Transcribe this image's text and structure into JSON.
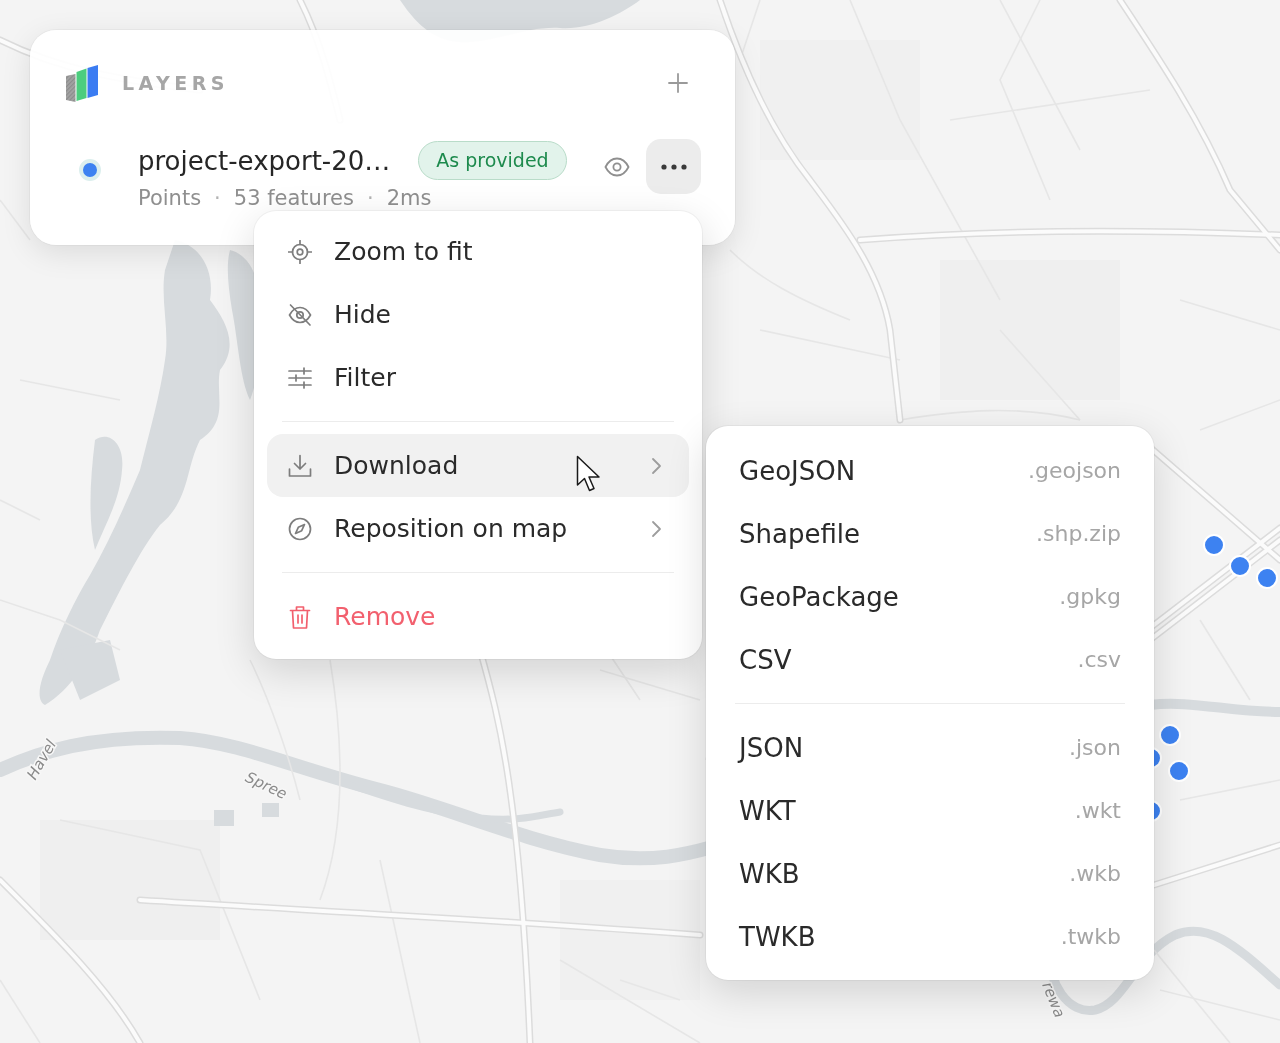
{
  "map": {
    "labels": [
      {
        "text": "Havel"
      },
      {
        "text": "Spree"
      },
      {
        "text": "rewa"
      }
    ]
  },
  "layers_panel": {
    "title": "LAYERS",
    "layers": [
      {
        "name": "project-export-20…",
        "selected": true,
        "badge": "As provided",
        "visible": true,
        "menu_open": true,
        "meta": [
          {
            "text": "Points"
          },
          {
            "separator": "·",
            "text": "53 features"
          },
          {
            "separator": "·",
            "text": "2ms"
          }
        ]
      }
    ]
  },
  "context_menu": {
    "groups": [
      {
        "items": [
          {
            "label": "Zoom to fit",
            "selected": false,
            "has_submenu": false,
            "destructive": false
          },
          {
            "label": "Hide",
            "selected": false,
            "has_submenu": false,
            "destructive": false
          },
          {
            "label": "Filter",
            "selected": false,
            "has_submenu": false,
            "destructive": false
          }
        ]
      },
      {
        "items": [
          {
            "label": "Download",
            "selected": true,
            "has_submenu": true,
            "destructive": false
          },
          {
            "label": "Reposition on map",
            "selected": false,
            "has_submenu": true,
            "destructive": false
          }
        ]
      },
      {
        "items": [
          {
            "label": "Remove",
            "selected": false,
            "has_submenu": false,
            "destructive": true
          }
        ]
      }
    ]
  },
  "submenu": {
    "groups": [
      {
        "items": [
          {
            "label": "GeoJSON",
            "extension": ".geojson",
            "selected": false
          },
          {
            "label": "Shapefile",
            "extension": ".shp.zip",
            "selected": false
          },
          {
            "label": "GeoPackage",
            "extension": ".gpkg",
            "selected": false
          },
          {
            "label": "CSV",
            "extension": ".csv",
            "selected": false
          }
        ]
      },
      {
        "items": [
          {
            "label": "JSON",
            "extension": ".json",
            "selected": false
          },
          {
            "label": "WKT",
            "extension": ".wkt",
            "selected": false
          },
          {
            "label": "WKB",
            "extension": ".wkb",
            "selected": false
          },
          {
            "label": "TWKB",
            "extension": ".twkb",
            "selected": false
          }
        ]
      }
    ]
  }
}
